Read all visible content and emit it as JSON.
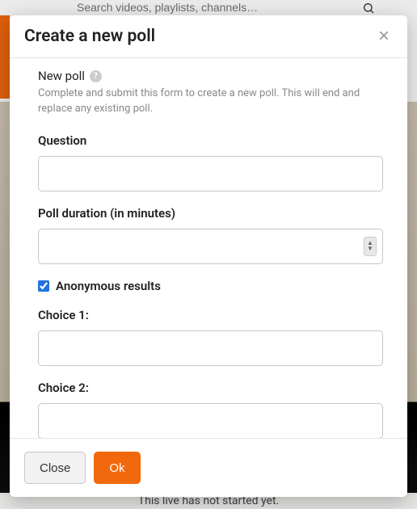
{
  "search": {
    "placeholder": "Search videos, playlists, channels…"
  },
  "status_text": "This live has not started yet.",
  "modal": {
    "title": "Create a new poll",
    "section_label": "New poll",
    "section_desc": "Complete and submit this form to create a new poll. This will end and replace any existing poll.",
    "labels": {
      "question": "Question",
      "duration": "Poll duration (in minutes)",
      "anonymous": "Anonymous results",
      "choice1": "Choice 1:",
      "choice2": "Choice 2:"
    },
    "values": {
      "question": "",
      "duration": "",
      "anonymous_checked": true,
      "choice1": "",
      "choice2": ""
    },
    "buttons": {
      "close": "Close",
      "ok": "Ok"
    }
  }
}
